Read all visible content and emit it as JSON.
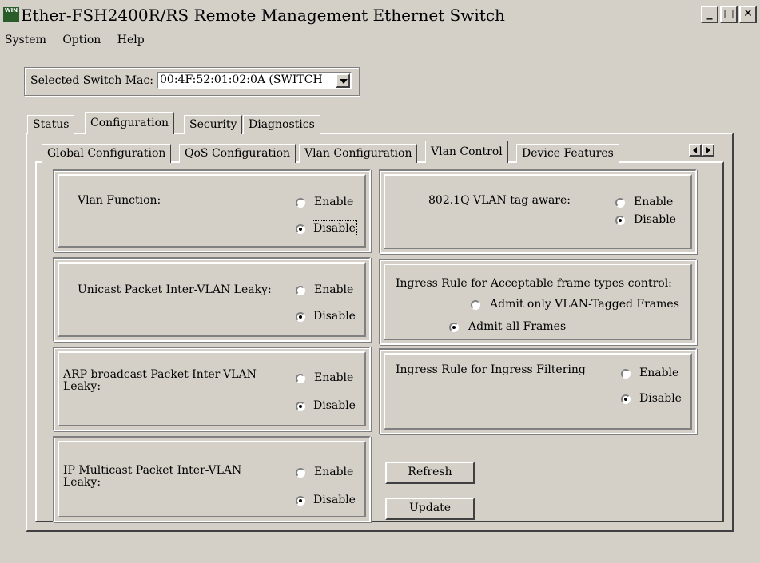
{
  "window": {
    "title": "Ether-FSH2400R/RS Remote Management Ethernet Switch",
    "icon_text": "WIN",
    "controls": {
      "minimize": "_",
      "maximize": "□",
      "close": "✕"
    }
  },
  "menu": {
    "items": [
      "System",
      "Option",
      "Help"
    ]
  },
  "selector": {
    "label": "Selected Switch Mac:",
    "value": "00:4F:52:01:02:0A (SWITCH"
  },
  "tabs": [
    {
      "label": "Status"
    },
    {
      "label": "Configuration"
    },
    {
      "label": "Security"
    },
    {
      "label": "Diagnostics"
    }
  ],
  "subtabs": [
    {
      "label": "Global Configuration"
    },
    {
      "label": "QoS Configuration"
    },
    {
      "label": "Vlan Configuration"
    },
    {
      "label": "Vlan Control"
    },
    {
      "label": "Device Features"
    }
  ],
  "radio_labels": {
    "enable": "Enable",
    "disable": "Disable"
  },
  "groups": {
    "vlan_function": {
      "label": "Vlan Function:",
      "selected": "Disable"
    },
    "unicast_leaky": {
      "label": "Unicast Packet Inter-VLAN Leaky:",
      "selected": "Disable"
    },
    "arp_leaky": {
      "label_line1": "ARP broadcast Packet Inter-VLAN",
      "label_line2": "Leaky:",
      "selected": "Disable"
    },
    "ip_multicast_leaky": {
      "label_line1": "IP Multicast Packet Inter-VLAN",
      "label_line2": "Leaky:",
      "selected": "Disable"
    },
    "tag_aware": {
      "label": "802.1Q VLAN tag aware:",
      "selected": "Disable"
    },
    "ingress_frame_types": {
      "label": "Ingress Rule for Acceptable frame types control:",
      "option1": "Admit only VLAN-Tagged Frames",
      "option2": "Admit all Frames",
      "selected": "Admit all Frames"
    },
    "ingress_filtering": {
      "label": "Ingress Rule for Ingress Filtering",
      "selected": "Disable"
    }
  },
  "buttons": {
    "refresh": "Refresh",
    "update": "Update"
  }
}
